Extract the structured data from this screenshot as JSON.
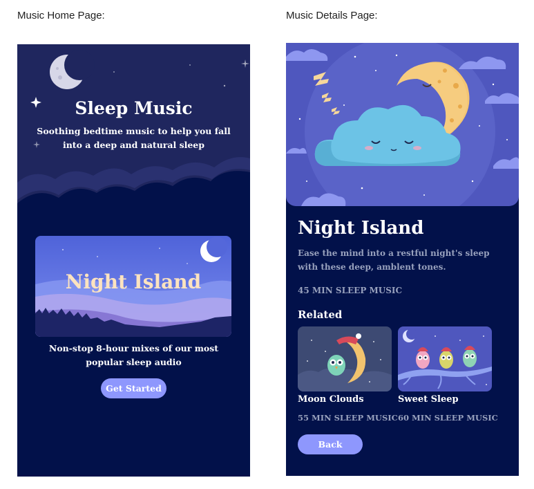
{
  "captions": {
    "home": "Music Home Page:",
    "details": "Music Details Page:"
  },
  "home": {
    "title": "Sleep Music",
    "subtitle": "Soothing bedtime music to help you fall into a deep and natural sleep",
    "featured": {
      "title": "Night Island"
    },
    "description": "Non-stop 8-hour mixes of our most popular sleep audio",
    "cta_label": "Get Started"
  },
  "details": {
    "title": "Night Island",
    "description": "Ease the mind into a restful night's sleep with these deep, amblent tones.",
    "duration": "45 MIN SLEEP MUSIC",
    "related_heading": "Related",
    "related": [
      {
        "name": "Moon Clouds",
        "duration": "55 MIN SLEEP MUSIC"
      },
      {
        "name": "Sweet Sleep",
        "duration": "60 MIN SLEEP MUSIC"
      }
    ],
    "back_label": "Back"
  },
  "colors": {
    "background": "#02114a",
    "accent": "#8e97fd",
    "muted_text": "#98a1bd",
    "featured_title": "#fde3bf"
  },
  "icons": [
    "crescent-moon-icon",
    "sparkle-icon",
    "sleeping-cloud-icon",
    "owl-icon"
  ]
}
